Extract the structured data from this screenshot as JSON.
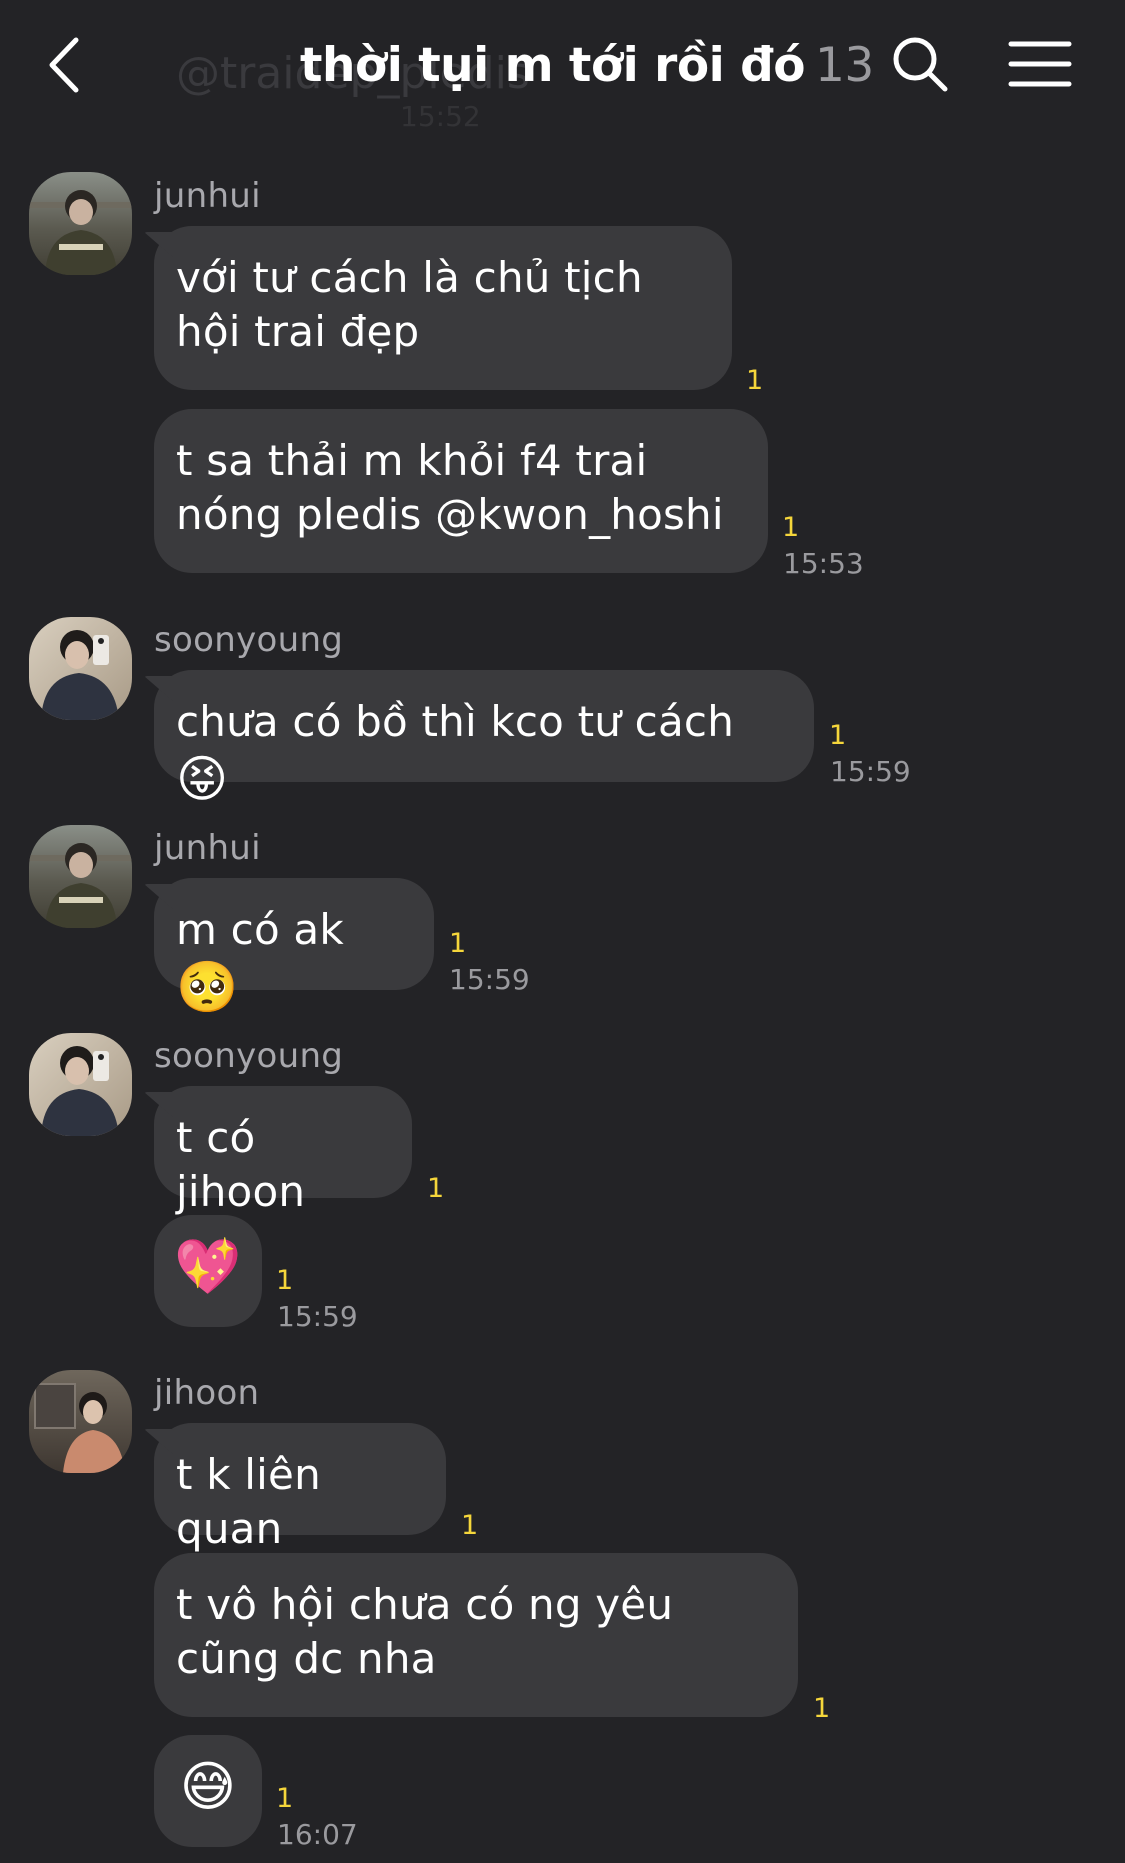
{
  "header": {
    "ghost_mention": "@traidep_pledis",
    "ghost_time": "15:52",
    "title": "thời tụi m tới rồi đó",
    "member_count": "13"
  },
  "messages": [
    {
      "sender": "junhui",
      "text": "với tư cách là chủ tịch hội trai đẹp",
      "unread": "1",
      "time": ""
    },
    {
      "sender": "",
      "text": "t sa thải m khỏi f4 trai nóng pledis @kwon_hoshi",
      "unread": "1",
      "time": "15:53"
    },
    {
      "sender": "soonyoung",
      "text": "chưa có bồ thì kco tư cách",
      "emoji": "😝",
      "unread": "1",
      "time": "15:59"
    },
    {
      "sender": "junhui",
      "text": "m có ak",
      "emoji": "🥺",
      "unread": "1",
      "time": "15:59"
    },
    {
      "sender": "soonyoung",
      "text": "t có jihoon",
      "unread": "1",
      "time": ""
    },
    {
      "sender": "",
      "text": "",
      "emoji": "💖",
      "unread": "1",
      "time": "15:59"
    },
    {
      "sender": "jihoon",
      "text": "t k liên quan",
      "unread": "1",
      "time": ""
    },
    {
      "sender": "",
      "text": "t vô hội chưa có ng yêu cũng dc nha",
      "unread": "1",
      "time": ""
    },
    {
      "sender": "",
      "text": "",
      "emoji": "😅",
      "unread": "1",
      "time": "16:07"
    }
  ],
  "icons": {
    "back": "chevron-left-icon",
    "search": "search-icon",
    "menu": "hamburger-menu-icon"
  },
  "colors": {
    "background": "#232326",
    "bubble": "#3a3a3d",
    "unread": "#f5d63b",
    "meta_text": "#9a9a9e"
  }
}
